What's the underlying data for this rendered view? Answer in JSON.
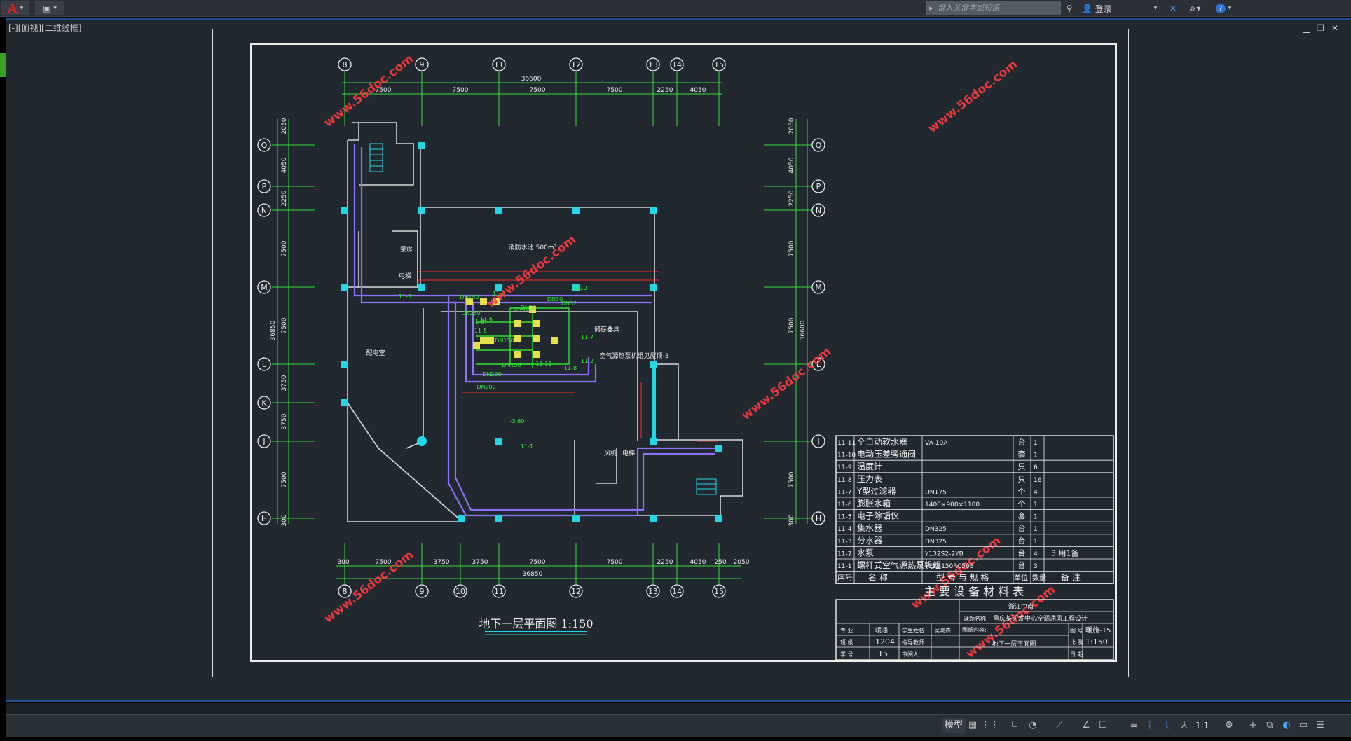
{
  "titlebar": {
    "search_placeholder": "键入关键字或短语",
    "login": "登录"
  },
  "viewport": {
    "label": "[-][俯视][二维线框]"
  },
  "plan": {
    "top_axes": [
      "8",
      "9",
      "11",
      "12",
      "13",
      "14",
      "15"
    ],
    "bottom_axes": [
      "8",
      "9",
      "10",
      "11",
      "12",
      "13",
      "14",
      "15"
    ],
    "left_axes": [
      "Q",
      "P",
      "N",
      "M",
      "L",
      "K",
      "J",
      "H"
    ],
    "right_axes": [
      "Q",
      "P",
      "N",
      "M",
      "L",
      "J",
      "H"
    ],
    "top_total": "36600",
    "top_dims": [
      "7500",
      "7500",
      "7500",
      "7500",
      "2250",
      "4050"
    ],
    "bottom_total": "36850",
    "bottom_dims": [
      "300",
      "7500",
      "3750",
      "3750",
      "7500",
      "7500",
      "2250",
      "4050",
      "250",
      "2050"
    ],
    "left_dims": [
      "2050",
      "4050",
      "2250",
      "7500",
      "7500",
      "3750",
      "3750",
      "7500",
      "300"
    ],
    "left_total": "36850",
    "right_dims": [
      "2050",
      "4050",
      "2250",
      "7500",
      "7500",
      "7500",
      "300"
    ],
    "right_total": "36600",
    "room_labels": [
      "消防水池 500m³",
      "配电室",
      "泵房",
      "电梯",
      "风机",
      "电梯",
      "储存器具",
      "空气源热泵机组见屋顶-3"
    ],
    "pipe_labels": [
      "DN150",
      "DN150",
      "DN150",
      "DN200",
      "DN200",
      "DN250",
      "DN30",
      "DN32",
      "DN40",
      "DN50",
      "11-3",
      "11-4",
      "11-5",
      "11-6",
      "11-7",
      "11-8",
      "11-9",
      "11-10",
      "11-11",
      "11-2",
      "11-1",
      "-3.60"
    ],
    "caption": "地下一层平面图 1:150",
    "watermark": "www.56doc.com"
  },
  "equipment_table": {
    "rows": [
      {
        "no": "11-11",
        "name": "全自动软水器",
        "model": "VA-10A",
        "unit": "台",
        "qty": "1",
        "note": ""
      },
      {
        "no": "11-10",
        "name": "电动压差旁通阀",
        "model": "",
        "unit": "套",
        "qty": "1",
        "note": ""
      },
      {
        "no": "11-9",
        "name": "温度计",
        "model": "",
        "unit": "只",
        "qty": "6",
        "note": ""
      },
      {
        "no": "11-8",
        "name": "压力表",
        "model": "",
        "unit": "只",
        "qty": "16",
        "note": ""
      },
      {
        "no": "11-7",
        "name": "Y型过滤器",
        "model": "DN175",
        "unit": "个",
        "qty": "4",
        "note": ""
      },
      {
        "no": "11-6",
        "name": "膨胀水箱",
        "model": "1400×900×1100",
        "unit": "个",
        "qty": "1",
        "note": ""
      },
      {
        "no": "11-5",
        "name": "电子除垢仪",
        "model": "",
        "unit": "套",
        "qty": "1",
        "note": ""
      },
      {
        "no": "11-4",
        "name": "集水器",
        "model": "DN325",
        "unit": "台",
        "qty": "1",
        "note": ""
      },
      {
        "no": "11-3",
        "name": "分水器",
        "model": "DN325",
        "unit": "台",
        "qty": "1",
        "note": ""
      },
      {
        "no": "11-2",
        "name": "水泵",
        "model": "Y132S2-2YB",
        "unit": "台",
        "qty": "4",
        "note": "3 用1备"
      },
      {
        "no": "11-1",
        "name": "螺杆式空气源热泵机组",
        "model": "YEXS150RC50B",
        "unit": "台",
        "qty": "3",
        "note": ""
      }
    ],
    "header": {
      "no": "序号",
      "name": "名 称",
      "model": "型 号 与 规 格",
      "unit": "单位",
      "qty": "数量",
      "note": "备 注"
    },
    "title": "主 要 设 备 材 料 表"
  },
  "title_block": {
    "school": "浙江中南",
    "design_label": "课题名称",
    "design_title": "重庆某研发中心空调通风工程设计",
    "major_label": "专 业",
    "major": "暖通",
    "class_label": "班 级",
    "class": "1204",
    "id_label": "学 号",
    "id": "15",
    "drawing_content_label": "图纸内容:",
    "drawing_content": "地下一层平面图",
    "sheet_no_label": "图 号",
    "sheet_no": "暖施-15",
    "scale_label": "比 例",
    "scale": "1:150",
    "date_label": "日 期",
    "student_label": "学生姓名",
    "student": "侯晓森",
    "advisor_label": "指导教师",
    "reviewer_label": "审阅人"
  },
  "statusbar": {
    "model": "模型",
    "scale": "1:1"
  }
}
